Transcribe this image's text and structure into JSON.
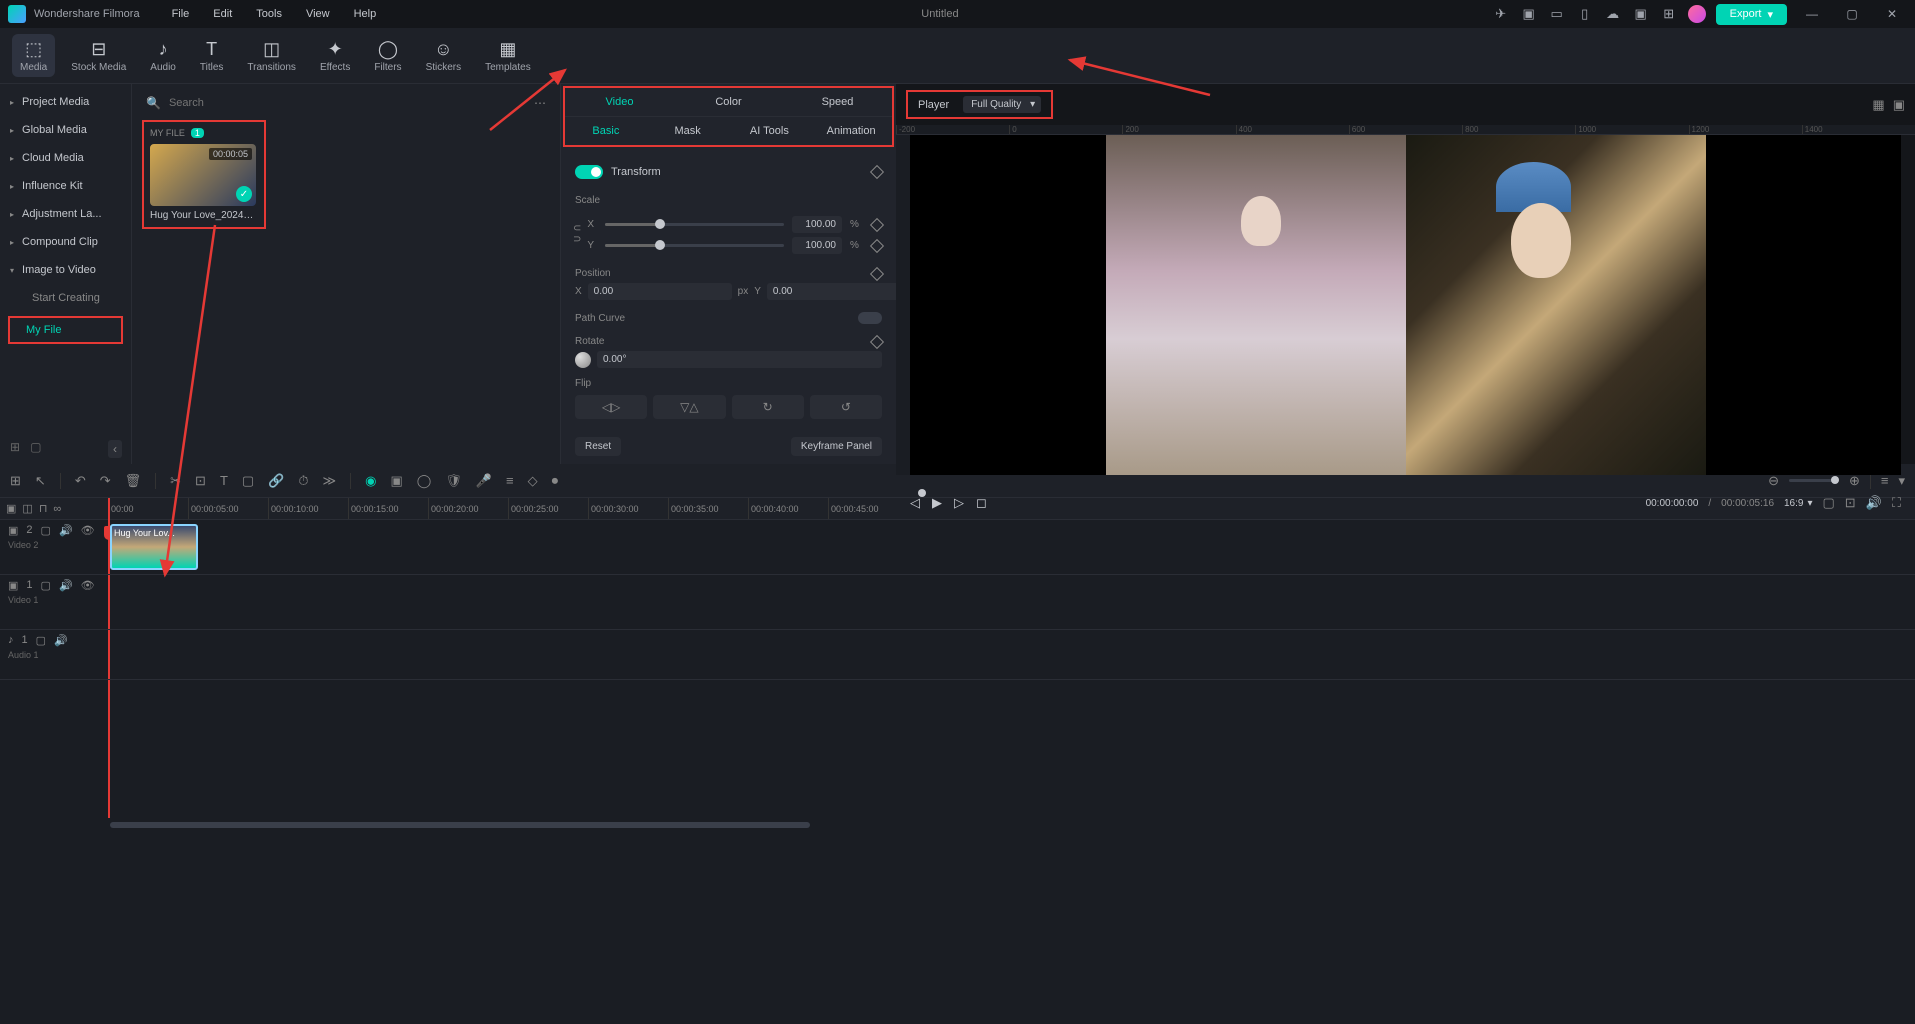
{
  "app": {
    "name": "Wondershare Filmora",
    "document_title": "Untitled"
  },
  "menu": [
    "File",
    "Edit",
    "Tools",
    "View",
    "Help"
  ],
  "export_label": "Export",
  "tools": [
    {
      "label": "Media",
      "icon": "⬚"
    },
    {
      "label": "Stock Media",
      "icon": "⬚"
    },
    {
      "label": "Audio",
      "icon": "♪"
    },
    {
      "label": "Titles",
      "icon": "T"
    },
    {
      "label": "Transitions",
      "icon": "◫"
    },
    {
      "label": "Effects",
      "icon": "✦"
    },
    {
      "label": "Filters",
      "icon": "◯"
    },
    {
      "label": "Stickers",
      "icon": "☺"
    },
    {
      "label": "Templates",
      "icon": "▦"
    }
  ],
  "sidebar": {
    "items": [
      "Project Media",
      "Global Media",
      "Cloud Media",
      "Influence Kit",
      "Adjustment La...",
      "Compound Clip",
      "Image to Video"
    ],
    "subitems": [
      "Start Creating",
      "My File"
    ]
  },
  "search": {
    "placeholder": "Search"
  },
  "media": {
    "section_label": "MY FILE",
    "badge": "1",
    "clip_duration": "00:00:05",
    "clip_name": "Hug Your Love_2024_1..."
  },
  "inspector": {
    "tabs_top": [
      "Video",
      "Color",
      "Speed"
    ],
    "tabs_sub": [
      "Basic",
      "Mask",
      "AI Tools",
      "Animation"
    ],
    "transform_label": "Transform",
    "scale_label": "Scale",
    "scale_x": "100.00",
    "scale_y": "100.00",
    "scale_unit": "%",
    "position_label": "Position",
    "pos_x": "0.00",
    "pos_y": "0.00",
    "pos_unit": "px",
    "pathcurve_label": "Path Curve",
    "rotate_label": "Rotate",
    "rotate_value": "0.00°",
    "flip_label": "Flip",
    "reset_label": "Reset",
    "keyframe_panel_label": "Keyframe Panel",
    "axis_x": "X",
    "axis_y": "Y"
  },
  "preview": {
    "player_label": "Player",
    "quality": "Full Quality",
    "ruler_ticks": [
      "-200",
      "0",
      "200",
      "400",
      "600",
      "800",
      "1000",
      "1200",
      "1400"
    ],
    "timecode": "00:00:00:00",
    "duration": "00:00:05:16",
    "aspect": "16:9"
  },
  "timeline": {
    "ruler_marks": [
      "00:00",
      "00:00:05:00",
      "00:00:10:00",
      "00:00:15:00",
      "00:00:20:00",
      "00:00:25:00",
      "00:00:30:00",
      "00:00:35:00",
      "00:00:40:00",
      "00:00:45:00"
    ],
    "tracks": [
      {
        "name": "Video 2",
        "icon": "▣",
        "num": "2"
      },
      {
        "name": "Video 1",
        "icon": "▣",
        "num": "1"
      },
      {
        "name": "Audio 1",
        "icon": "♪",
        "num": "1"
      }
    ],
    "clip_label": "Hug Your Lov..."
  }
}
